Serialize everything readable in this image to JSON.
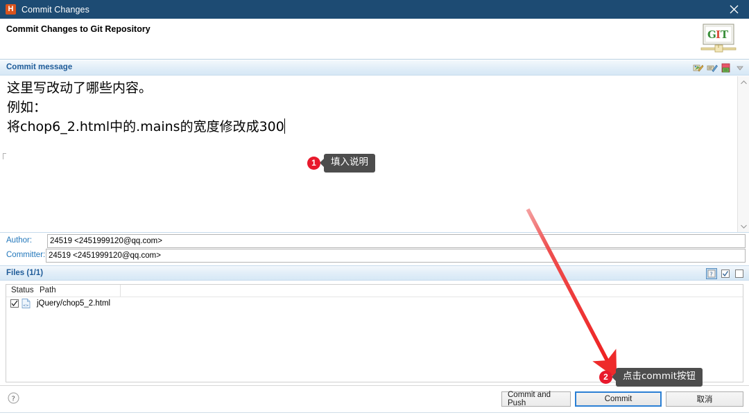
{
  "window": {
    "app_icon": "h-app-icon",
    "title": "Commit Changes",
    "close_label": "close-icon"
  },
  "header": {
    "title": "Commit Changes to Git Repository",
    "logo": {
      "name": "git-logo",
      "letters": [
        "G",
        "I",
        "T"
      ],
      "letter_colors": [
        "#3b8f3b",
        "#d94b3a",
        "#3b8f3b"
      ]
    }
  },
  "commit_message": {
    "section_label": "Commit message",
    "text_lines": [
      "这里写改动了哪些内容。",
      "例如：",
      "将chop6_2.html中的.mains的宽度修改成300"
    ],
    "toolbar_icons": [
      "amend-commit-icon",
      "signed-off-icon",
      "add-change-id-icon",
      "dropdown-arrow-icon"
    ],
    "scrollbar": {
      "up_arrow": "chevron-up-icon",
      "down_arrow": "chevron-down-icon"
    }
  },
  "author": {
    "label": "Author:",
    "value": "24519 <2451999120@qq.com>"
  },
  "committer": {
    "label": "Committer:",
    "value": "24519 <2451999120@qq.com>"
  },
  "files": {
    "section_label": "Files (1/1)",
    "toolbar_icons": [
      "show-untracked-icon",
      "select-all-icon",
      "deselect-all-icon"
    ],
    "columns": [
      "Status",
      "Path"
    ],
    "rows": [
      {
        "checked": true,
        "status_icon": "modified-file-icon",
        "path": "jQuery/chop5_2.html"
      }
    ]
  },
  "footer": {
    "help_icon": "help-icon",
    "buttons": [
      {
        "label": "Commit and Push",
        "primary": false
      },
      {
        "label": "Commit",
        "primary": true
      },
      {
        "label": "取消",
        "primary": false
      }
    ]
  },
  "annotations": [
    {
      "number": "1",
      "text": "填入说明"
    },
    {
      "number": "2",
      "text": "点击commit按钮"
    }
  ],
  "colors": {
    "titlebar": "#1d4b73",
    "section_header_text": "#1f5c99",
    "field_label": "#2277bb",
    "annotation_red": "#e8192c",
    "annotation_bubble": "#4d4d4d",
    "arrow_red": "#ee2b2b",
    "primary_button_border": "#2a7fd4",
    "app_icon": "#d9541e"
  }
}
